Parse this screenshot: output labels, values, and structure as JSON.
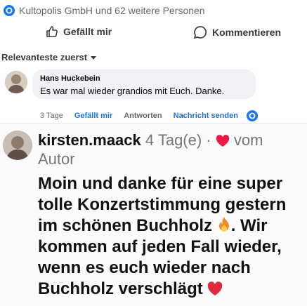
{
  "facebook": {
    "reactions_text": "Kultopolis GmbH und 62 weitere Personen",
    "actions": {
      "like_label": "Gefällt mir",
      "comment_label": "Kommentieren"
    },
    "sort_label": "Relevanteste zuerst",
    "comment": {
      "author": "Hans Huckebein",
      "text": "Es war mal wieder grandios mit Euch. Danke.",
      "meta": {
        "time": "3 Tage",
        "like": "Gefällt mir",
        "reply": "Antworten",
        "message": "Nachricht senden"
      }
    },
    "colors": {
      "blue": "#1877f2",
      "bubble": "#f0f2f5"
    }
  },
  "instagram_comment": {
    "username": "kirsten.maack",
    "time": "4 Tag(e) ·",
    "liked_by": "vom Autor",
    "text_parts": [
      "Moin und danke für eine super tolle Konzertstimmung gestern im schönen Buchholz ",
      ". Wir kommen auf jeden Fall wieder, wenn es euch wieder nach Buchholz verschlägt "
    ],
    "icons": {
      "heart": "heart-icon",
      "fire": "fire-emoji",
      "red_heart": "heart-emoji"
    }
  }
}
